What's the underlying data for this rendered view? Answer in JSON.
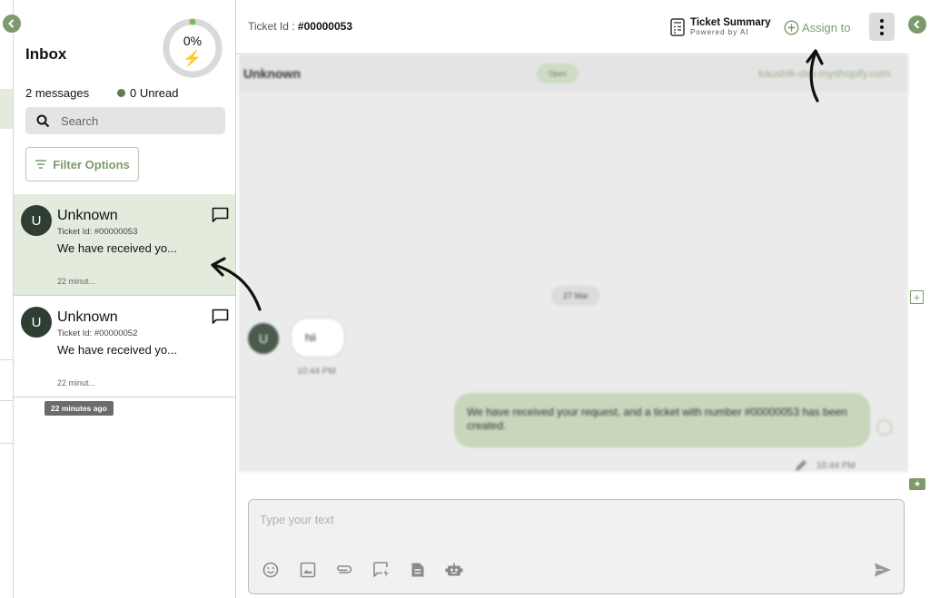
{
  "inbox": {
    "title": "Inbox",
    "progress_label": "0%",
    "progress_value": 0,
    "message_count": "2 messages",
    "unread": "0 Unread",
    "search_placeholder": "Search",
    "filter_label": "Filter Options",
    "tooltip": "22 minutes ago",
    "tickets": [
      {
        "avatar": "U",
        "name": "Unknown",
        "ticket_id": "Ticket Id: #00000053",
        "preview": "We have received yo...",
        "time": "22 minut..."
      },
      {
        "avatar": "U",
        "name": "Unknown",
        "ticket_id": "Ticket Id: #00000052",
        "preview": "We have received yo...",
        "time": "22 minut..."
      }
    ]
  },
  "header": {
    "ticket_label": "Ticket Id :",
    "ticket_number": "#00000053",
    "summary_title": "Ticket Summary",
    "summary_sub": "Powered by AI",
    "assign_label": "Assign to"
  },
  "chat": {
    "contact": "Unknown",
    "status": "Open",
    "store": "kaushik-dev.myshopify.com",
    "date_chip": "27 Mar",
    "incoming": {
      "avatar": "U",
      "text": "hii",
      "time": "10:44 PM"
    },
    "outgoing": {
      "text": "We have received your request, and a ticket with number #00000053 has been created.",
      "time": "10:44 PM"
    }
  },
  "composer": {
    "placeholder": "Type your text"
  },
  "icons": [
    "chevron-left-icon",
    "bolt-icon",
    "search-icon",
    "filter-icon",
    "chat-bubble-icon",
    "calculator-icon",
    "plus-circle-icon",
    "more-vertical-icon",
    "plus-square-icon",
    "ticket-icon",
    "emoji-icon",
    "image-icon",
    "attachment-icon",
    "quick-reply-icon",
    "document-icon",
    "bot-icon",
    "send-icon",
    "pencil-icon"
  ],
  "colors": {
    "accent": "#7d9a6a",
    "active_row": "#e3ebdd",
    "outgoing_bubble": "#c8d6bc",
    "avatar": "#2f3e33",
    "unread_dot": "#5f7d4e",
    "bolt": "#f2b134"
  }
}
